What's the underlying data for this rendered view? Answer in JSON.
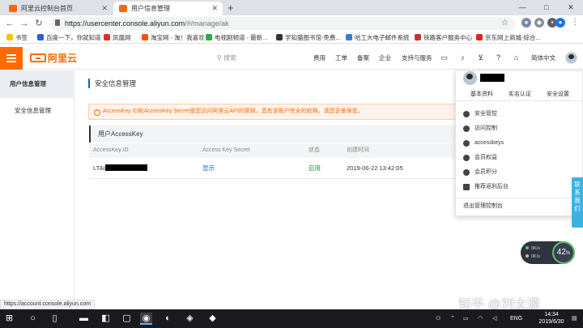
{
  "browser": {
    "tabs": [
      {
        "label": "阿里云控制台首页",
        "active": false
      },
      {
        "label": "用户信息管理",
        "active": true
      }
    ],
    "new_tab": "+",
    "window_controls": {
      "minimize": "—",
      "maximize": "□",
      "close": "✕"
    },
    "url_host": "https://usercenter.console.aliyun.com",
    "url_path": "/#/manage/ak",
    "bookmarks": [
      "书签",
      "百度一下，你就知道",
      "凤凰网",
      "淘宝网 - 淘！我喜欢",
      "电视剧频道 - 最新...",
      "学知猫图书馆-免费...",
      "哈工大电子邮件系统",
      "铁路客户服务中心",
      "京东网上商城-综合..."
    ]
  },
  "header": {
    "logo_text": "阿里云",
    "search_placeholder": "搜索",
    "nav": [
      "费用",
      "工单",
      "备案",
      "企业",
      "支持与服务"
    ],
    "lang": "简体中文"
  },
  "sidebar": {
    "title": "用户信息管理",
    "items": [
      "安全信息管理"
    ]
  },
  "main": {
    "page_title": "安全信息管理",
    "alert": "AccessKey ID和AccessKey Secret是您访问阿里云API的密钥，具有该账户完全的权限，请您妥善保管。",
    "panel_title": "用户AccessKey",
    "table": {
      "headers": [
        "AccessKey ID",
        "Access Key Secret",
        "状态",
        "创建时间"
      ],
      "rows": [
        {
          "id_prefix": "LTAI",
          "secret_link": "显示",
          "status": "启用",
          "created": "2019-06-22 13:42:05"
        }
      ]
    }
  },
  "user_menu": {
    "tabs": [
      "基本资料",
      "实名认证",
      "安全设置"
    ],
    "items": [
      "安全管控",
      "访问控制",
      "accesskeys",
      "会员权益",
      "会员积分",
      "推荐返利后台"
    ],
    "logout": "退出管理控制台"
  },
  "floating": {
    "contact": [
      "联",
      "系",
      "我",
      "们"
    ],
    "speed_up": "0K/s",
    "speed_down": "0K/s",
    "percent": "42",
    "percent_unit": "%"
  },
  "status_url": "https://account.console.aliyun.com",
  "watermark": "知乎 @刘太源",
  "taskbar": {
    "lang": "ENG",
    "time": "14:34",
    "date": "2019/6/30"
  },
  "colors": {
    "brand": "#ff6a00",
    "link": "#0070cc",
    "ok": "#1e8e3e"
  }
}
